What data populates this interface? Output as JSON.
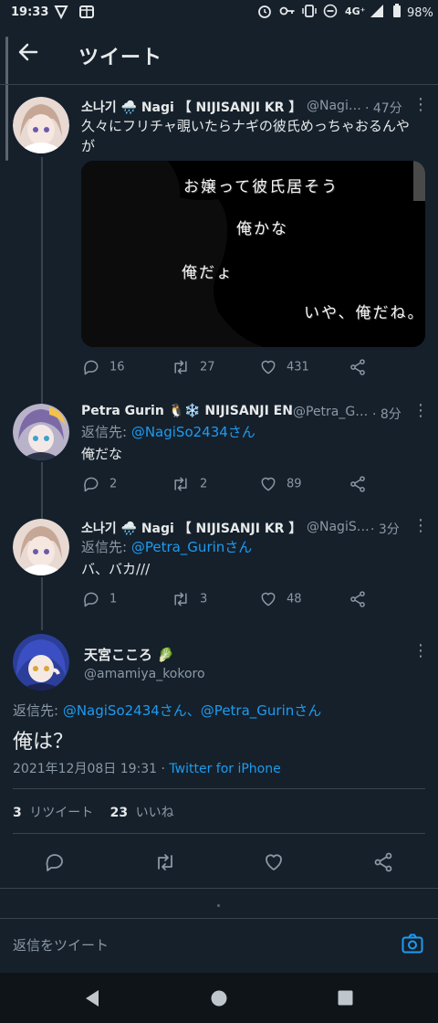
{
  "status_bar": {
    "time": "19:33",
    "network": "4G⁺",
    "battery": "98%"
  },
  "header": {
    "title": "ツイート"
  },
  "tweets": [
    {
      "name": "소나기 🌧️ Nagi 【 NIJISANJI KR 】",
      "handle": "@Nagi…",
      "time": "· 47分",
      "text": "久々にフリチャ覗いたらナギの彼氏めっちゃおるんやが",
      "media_lines": [
        "お嬢って彼氏居そう",
        "俺かな",
        "俺だょ",
        "いや、俺だね。"
      ],
      "replies": "16",
      "retweets": "27",
      "likes": "431"
    },
    {
      "name": "Petra Gurin 🐧❄️ NIJISANJI EN",
      "handle": "@Petra_G…",
      "time": "· 8分",
      "reply_prefix": "返信先: ",
      "reply_to": "@NagiSo2434さん",
      "text": "俺だな",
      "replies": "2",
      "retweets": "2",
      "likes": "89"
    },
    {
      "name": "소나기 🌧️ Nagi 【 NIJISANJI KR 】",
      "handle": "@NagiS…",
      "time": "· 3分",
      "reply_prefix": "返信先: ",
      "reply_to": "@Petra_Gurinさん",
      "text": "バ、バカ///",
      "replies": "1",
      "retweets": "3",
      "likes": "48"
    }
  ],
  "main_tweet": {
    "name": "天宮こころ 🥬",
    "handle": "@amamiya_kokoro",
    "reply_prefix": "返信先: ",
    "reply_to": "@NagiSo2434さん、@Petra_Gurinさん",
    "text": "俺は？",
    "datetime": "2021年12月08日 19:31 · ",
    "source": "Twitter for iPhone",
    "retweet_count": "3",
    "retweet_label": "リツイート",
    "like_count": "23",
    "like_label": "いいね"
  },
  "reply_bar": {
    "placeholder": "返信をツイート"
  },
  "colors": {
    "background": "#15202b",
    "accent": "#1d9bf0",
    "muted": "#8b98a5"
  }
}
